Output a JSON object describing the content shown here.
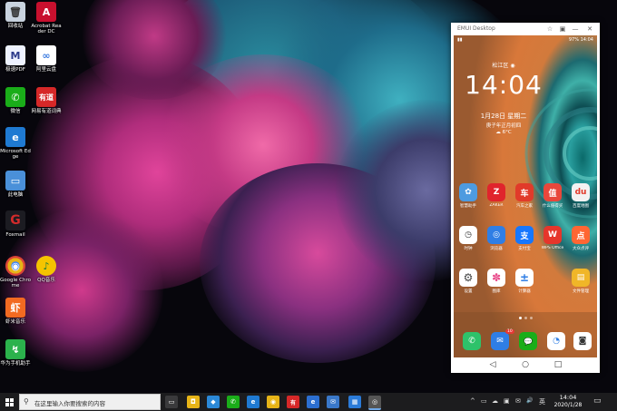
{
  "desktop": {
    "icons": [
      {
        "label": "回收站",
        "glyph": "🗑",
        "color": "#c9d3df"
      },
      {
        "label": "Acrobat Reader DC",
        "glyph": "A",
        "color": "#c8102e"
      },
      {
        "label": "极速PDF",
        "glyph": "M",
        "color": "#eef2ff"
      },
      {
        "label": "阿里云盘",
        "glyph": "∞",
        "color": "#ffffff"
      },
      {
        "label": "微信",
        "glyph": "✆",
        "color": "#1aad19"
      },
      {
        "label": "网易有道词典",
        "glyph": "有道",
        "color": "#d62828"
      },
      {
        "label": "Microsoft Edge",
        "glyph": "e",
        "color": "#1f7ad2"
      },
      {
        "label": "此电脑",
        "glyph": "▭",
        "color": "#4a90d9"
      },
      {
        "label": "Foxmail",
        "glyph": "G",
        "color": "#d22b2b"
      },
      {
        "label": "Google Chrome",
        "glyph": "◉",
        "color": "#e7b417"
      },
      {
        "label": "QQ音乐",
        "glyph": "♪",
        "color": "#f5c400"
      },
      {
        "label": "虾米音乐",
        "glyph": "虾",
        "color": "#f26a21"
      },
      {
        "label": "华为手机助手",
        "glyph": "↯",
        "color": "#2bb24c"
      }
    ]
  },
  "phone_window": {
    "title": "EMUI Desktop",
    "status_left": "",
    "status_right": "97% 14:04",
    "location": "松江区",
    "clock": "14:04",
    "date": "1月28日 星期二",
    "lunar": "庚子年正月初四",
    "weather": "6°C",
    "apps_row1": [
      {
        "label": "智慧助手",
        "glyph": "✿",
        "color": "#4d9be0"
      },
      {
        "label": "ZAKER",
        "glyph": "Z",
        "color": "#e0242c"
      },
      {
        "label": "汽车之家",
        "glyph": "车",
        "color": "#e13a2a"
      },
      {
        "label": "什么值得买",
        "glyph": "值",
        "color": "#e8473b"
      },
      {
        "label": "百度地图",
        "glyph": "du",
        "color": "#f2f2f2"
      }
    ],
    "apps_row2": [
      {
        "label": "时钟",
        "glyph": "◷",
        "color": "#ffffff"
      },
      {
        "label": "浏览器",
        "glyph": "◎",
        "color": "#2f7ee5"
      },
      {
        "label": "支付宝",
        "glyph": "支",
        "color": "#1677ff"
      },
      {
        "label": "WPS Office",
        "glyph": "W",
        "color": "#e6352b"
      },
      {
        "label": "大众点评",
        "glyph": "点",
        "color": "#ff6633"
      }
    ],
    "apps_row3": [
      {
        "label": "设置",
        "glyph": "⚙",
        "color": "#ffffff"
      },
      {
        "label": "图库",
        "glyph": "✽",
        "color": "#ffffff"
      },
      {
        "label": "计算器",
        "glyph": "±",
        "color": "#ffffff"
      },
      {
        "label": "文件管理",
        "glyph": "▤",
        "color": "#f0b628"
      }
    ],
    "dock": [
      {
        "glyph": "✆",
        "color": "#2ec26a",
        "badge": ""
      },
      {
        "glyph": "✉",
        "color": "#2f7ee5",
        "badge": "10"
      },
      {
        "glyph": "💬",
        "color": "#1aad19",
        "badge": ""
      },
      {
        "glyph": "◔",
        "color": "#ffffff",
        "badge": ""
      },
      {
        "glyph": "◙",
        "color": "#ffffff",
        "badge": ""
      }
    ],
    "titlebar_buttons": [
      "☆",
      "▣",
      "—",
      "✕"
    ]
  },
  "taskbar": {
    "search_placeholder": "在这里输入你要搜索的内容",
    "time": "14:04",
    "date": "2020/1/28",
    "apps": [
      {
        "glyph": "▭",
        "color": "#3a3a3c"
      },
      {
        "glyph": "◘",
        "color": "#e7b417"
      },
      {
        "glyph": "◆",
        "color": "#2b89d8"
      },
      {
        "glyph": "✆",
        "color": "#1aad19"
      },
      {
        "glyph": "e",
        "color": "#1f7ad2"
      },
      {
        "glyph": "◉",
        "color": "#e7b417"
      },
      {
        "glyph": "有",
        "color": "#d62828"
      },
      {
        "glyph": "e",
        "color": "#2c6fd1"
      },
      {
        "glyph": "✉",
        "color": "#3a78c9"
      },
      {
        "glyph": "▦",
        "color": "#2b7bd8"
      },
      {
        "glyph": "◎",
        "color": "#555555"
      }
    ],
    "tray_icons": [
      "^",
      "▭",
      "☁",
      "▣",
      "✉",
      "🔊",
      "英"
    ]
  }
}
